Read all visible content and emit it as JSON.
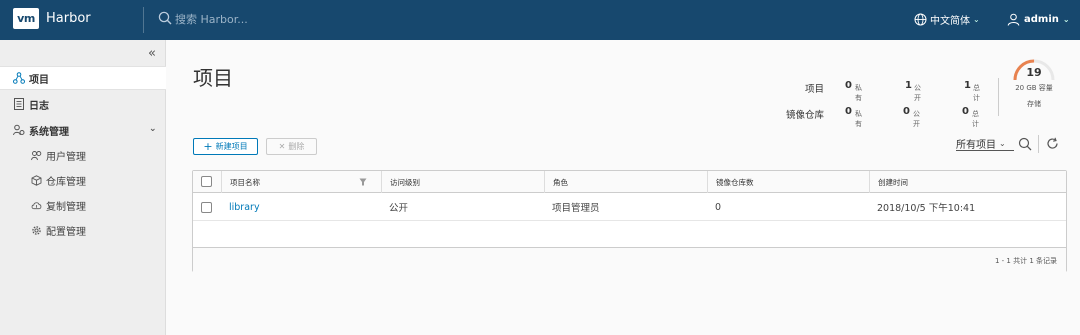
{
  "header": {
    "logo": "vm",
    "app_title": "Harbor",
    "search_placeholder": "搜索 Harbor...",
    "language": "中文简体",
    "user": "admin"
  },
  "sidebar": {
    "collapse_glyph": "«",
    "items": [
      {
        "label": "项目",
        "icon": "projects-icon",
        "active": true
      },
      {
        "label": "日志",
        "icon": "logs-icon"
      },
      {
        "label": "系统管理",
        "icon": "admin-icon",
        "expanded": true
      }
    ],
    "sub_items": [
      {
        "label": "用户管理",
        "icon": "users-icon"
      },
      {
        "label": "仓库管理",
        "icon": "registry-icon"
      },
      {
        "label": "复制管理",
        "icon": "replication-icon"
      },
      {
        "label": "配置管理",
        "icon": "config-icon"
      }
    ]
  },
  "main": {
    "title": "项目",
    "summary": {
      "projects_label": "项目",
      "repos_label": "镜像仓库",
      "projects": {
        "private": "0",
        "public": "1",
        "total": "1"
      },
      "repos": {
        "private": "0",
        "public": "0",
        "total": "0"
      },
      "private_unit": "私有",
      "public_unit": "公开",
      "total_unit": "总计"
    },
    "quota": {
      "count": "19",
      "capacity": "20 GB 容量",
      "label": "存储",
      "fill": 0.5,
      "color": "#e8824f"
    },
    "toolbar": {
      "new_label": "新建项目",
      "new_glyph": "+",
      "delete_label": "删除",
      "delete_glyph": "✕",
      "filter_value": "所有项目"
    },
    "table": {
      "columns": [
        "项目名称",
        "访问级别",
        "角色",
        "镜像仓库数",
        "创建时间"
      ],
      "rows": [
        {
          "name": "library",
          "access": "公开",
          "role": "项目管理员",
          "repo_count": "0",
          "created": "2018/10/5 下午10:41"
        }
      ],
      "footer": "1 - 1 共计 1 条记录"
    }
  },
  "colors": {
    "header_bg": "#17486e",
    "accent": "#0079b8",
    "sidebar_bg": "#eeeeee"
  }
}
